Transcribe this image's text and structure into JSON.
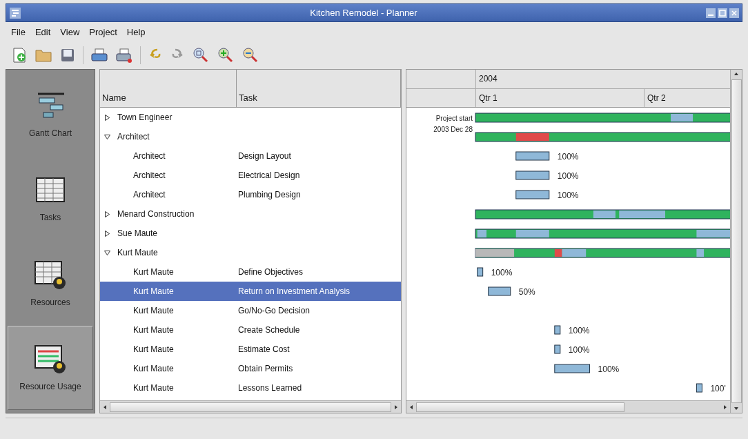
{
  "window": {
    "title": "Kitchen Remodel - Planner"
  },
  "menu": [
    "File",
    "Edit",
    "View",
    "Project",
    "Help"
  ],
  "sidebar": {
    "items": [
      {
        "label": "Gantt Chart",
        "selected": false
      },
      {
        "label": "Tasks",
        "selected": false
      },
      {
        "label": "Resources",
        "selected": false
      },
      {
        "label": "Resource Usage",
        "selected": true
      }
    ]
  },
  "table": {
    "columns": [
      "Name",
      "Task"
    ],
    "rows": [
      {
        "name": "Town Engineer",
        "expanded": false
      },
      {
        "name": "Architect",
        "expanded": true,
        "children": [
          {
            "name": "Architect",
            "task": "Design Layout",
            "selected": false,
            "bar_label": "100%"
          },
          {
            "name": "Architect",
            "task": "Electrical Design",
            "selected": false,
            "bar_label": "100%"
          },
          {
            "name": "Architect",
            "task": "Plumbing Design",
            "selected": false,
            "bar_label": "100%"
          }
        ]
      },
      {
        "name": "Menard Construction",
        "expanded": false
      },
      {
        "name": "Sue Maute",
        "expanded": false
      },
      {
        "name": "Kurt Maute",
        "expanded": true,
        "children": [
          {
            "name": "Kurt Maute",
            "task": "Define Objectives",
            "selected": false,
            "bar_label": "100%"
          },
          {
            "name": "Kurt Maute",
            "task": "Return on Investment Analysis",
            "selected": true,
            "bar_label": "50%"
          },
          {
            "name": "Kurt Maute",
            "task": "Go/No-Go Decision",
            "selected": false
          },
          {
            "name": "Kurt Maute",
            "task": "Create Schedule",
            "selected": false,
            "bar_label": "100%"
          },
          {
            "name": "Kurt Maute",
            "task": "Estimate Cost",
            "selected": false,
            "bar_label": "100%"
          },
          {
            "name": "Kurt Maute",
            "task": "Obtain Permits",
            "selected": false,
            "bar_label": "100%"
          },
          {
            "name": "Kurt Maute",
            "task": "Lessons Learned",
            "selected": false,
            "bar_label": "100'"
          }
        ]
      }
    ]
  },
  "timeline": {
    "year": "2004",
    "quarters": [
      "Qtr 1",
      "Qtr 2"
    ],
    "project_start": [
      "Project start",
      "2003 Dec 28"
    ]
  }
}
